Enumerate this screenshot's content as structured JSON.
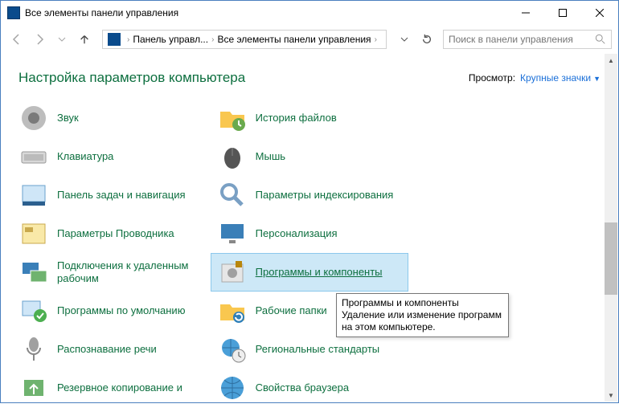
{
  "window": {
    "title": "Все элементы панели управления"
  },
  "breadcrumb": {
    "seg1": "Панель управл...",
    "seg2": "Все элементы панели управления"
  },
  "search": {
    "placeholder": "Поиск в панели управления"
  },
  "header": {
    "title": "Настройка параметров компьютера",
    "view_label": "Просмотр:",
    "view_value": "Крупные значки"
  },
  "items": {
    "sound": "Звук",
    "file_history": "История файлов",
    "keyboard": "Клавиатура",
    "mouse": "Мышь",
    "taskbar": "Панель задач и навигация",
    "indexing": "Параметры индексирования",
    "explorer": "Параметры Проводника",
    "personalization": "Персонализация",
    "rdp": "Подключения к удаленным рабочим",
    "programs": "Программы и компоненты",
    "defaults": "Программы по умолчанию",
    "workfolders": "Рабочие папки",
    "speech": "Распознавание речи",
    "region": "Региональные стандарты",
    "backup": "Резервное копирование и",
    "browser": "Свойства браузера"
  },
  "tooltip": {
    "title": "Программы и компоненты",
    "body": "Удаление или изменение программ на этом компьютере."
  }
}
